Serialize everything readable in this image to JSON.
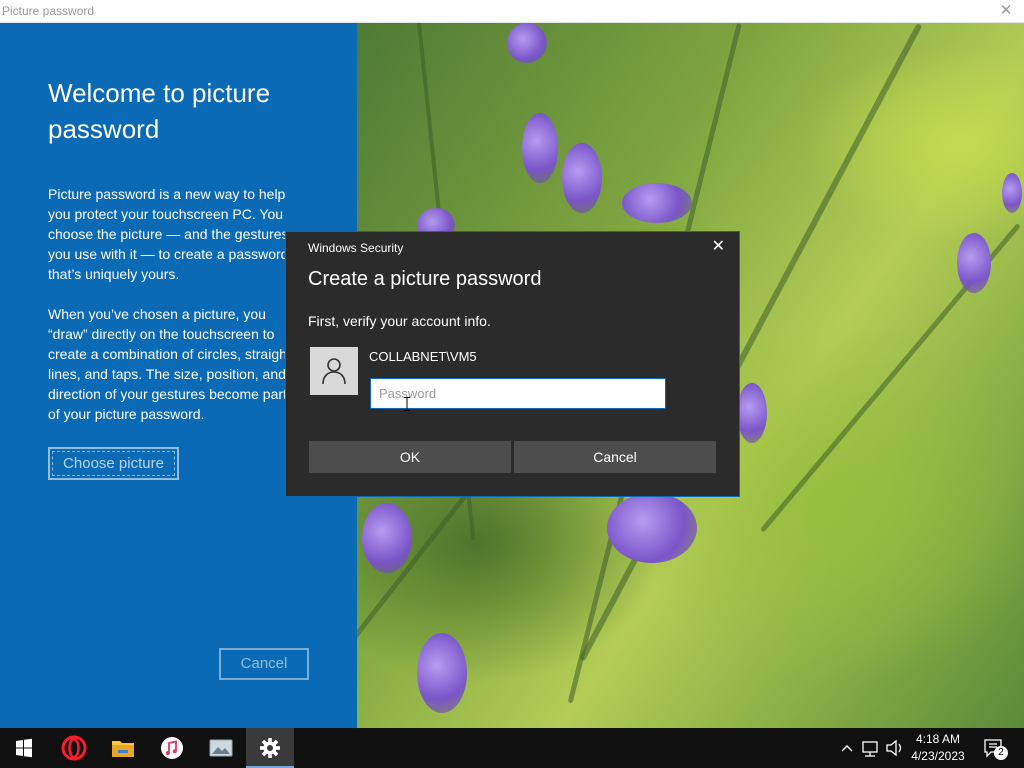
{
  "window": {
    "title": "Picture password"
  },
  "left_panel": {
    "heading_line1": "Welcome to picture",
    "heading_line2": "password",
    "para1": [
      "Picture password is a new way to help",
      "you protect your touchscreen PC. You",
      "choose the picture — and the gestures",
      "you use with it — to create a password",
      "that’s uniquely yours."
    ],
    "para2": [
      "When you’ve chosen a picture, you",
      "“draw” directly on the touchscreen to",
      "create a combination of circles, straight",
      "lines, and taps. The size, position, and",
      "direction of your gestures become part",
      "of your picture password."
    ],
    "choose_button": "Choose picture",
    "cancel_button": "Cancel"
  },
  "dialog": {
    "title": "Windows Security",
    "heading": "Create a picture password",
    "subtext": "First, verify your account info.",
    "account_name": "COLLABNET\\VM5",
    "password_placeholder": "Password",
    "password_value": "",
    "ok_button": "OK",
    "cancel_button": "Cancel"
  },
  "taskbar": {
    "apps": [
      {
        "name": "start-icon"
      },
      {
        "name": "opera-icon"
      },
      {
        "name": "file-explorer-icon"
      },
      {
        "name": "itunes-icon"
      },
      {
        "name": "photos-icon"
      },
      {
        "name": "settings-icon",
        "active": true
      }
    ],
    "clock_time": "4:18 AM",
    "clock_date": "4/23/2023",
    "notification_count": "2"
  },
  "colors": {
    "accent_blue": "#0a6ab6",
    "dialog_bg": "#2b2b2b",
    "button_bg": "#4d4d4d",
    "taskbar_bg": "#101010"
  }
}
